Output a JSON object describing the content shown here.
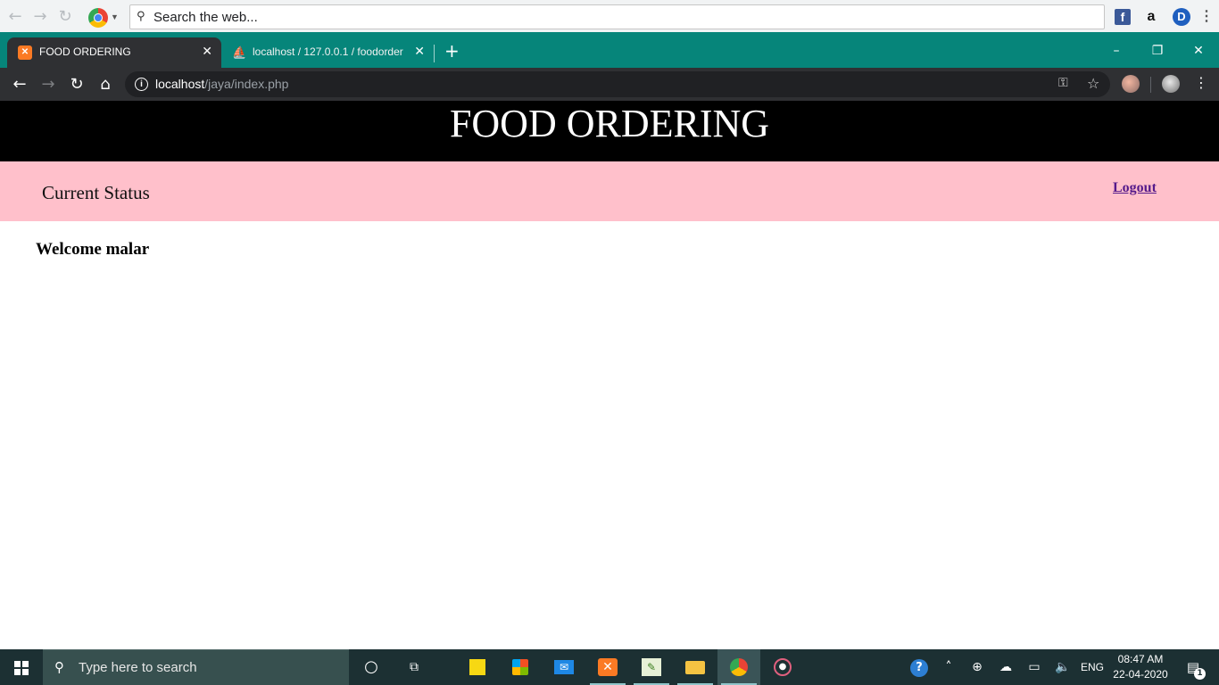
{
  "top_toolbar": {
    "search_placeholder": "Search the web...",
    "extensions": [
      "facebook-icon",
      "amazon-icon",
      "d-extension-icon",
      "menu-icon"
    ],
    "amazon_label": "a",
    "d_label": "D",
    "fb_label": "f"
  },
  "tabs": [
    {
      "title": "FOOD ORDERING",
      "favicon": "xampp-icon",
      "active": true
    },
    {
      "title": "localhost / 127.0.0.1 / foodorder",
      "favicon": "phpmyadmin-icon",
      "active": false
    }
  ],
  "window_controls": {
    "minimize": "–",
    "maximize": "❐",
    "close": "✕"
  },
  "address_bar": {
    "host": "localhost",
    "path": "/jaya/index.php"
  },
  "page": {
    "header_title": "FOOD ORDERING",
    "status_label": "Current Status",
    "logout_label": "Logout",
    "welcome_text": "Welcome malar"
  },
  "taskbar": {
    "search_placeholder": "Type here to search",
    "apps": [
      "cortana-icon",
      "task-view-icon",
      "sticky-notes-icon",
      "store-icon",
      "mail-icon",
      "xampp-icon",
      "notepad-plus-icon",
      "file-explorer-icon",
      "chrome-icon",
      "media-player-icon"
    ],
    "language": "ENG",
    "time": "08:47 AM",
    "date": "22-04-2020",
    "notification_count": "1"
  },
  "colors": {
    "tab_strip": "#06857a",
    "header_bg": "#000000",
    "status_bg": "#ffc0cb",
    "taskbar_bg": "#1c3033"
  }
}
